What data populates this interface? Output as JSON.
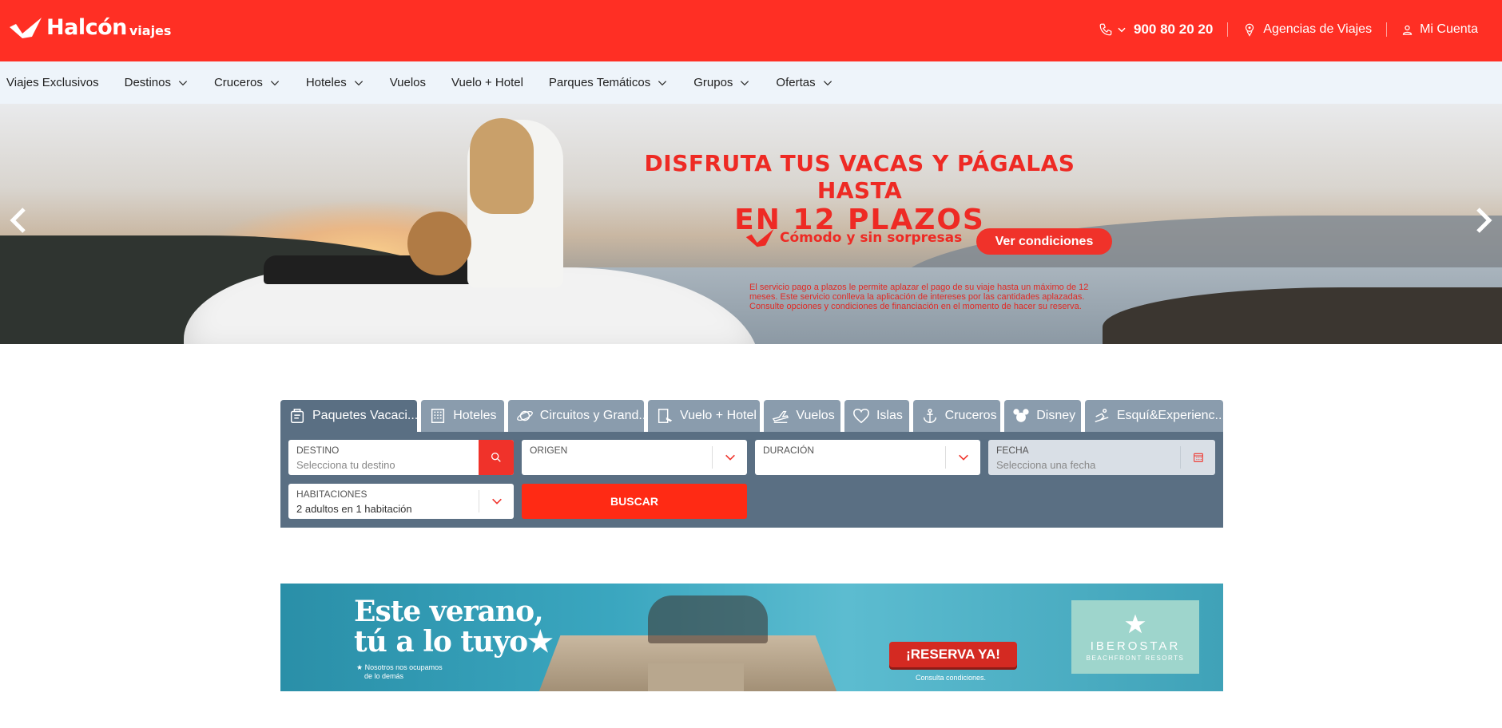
{
  "header": {
    "brand": "Halcón",
    "brand_sub": "viajes",
    "phone": "900 80 20 20",
    "agencias": "Agencias de Viajes",
    "cuenta": "Mi Cuenta"
  },
  "nav": {
    "items": [
      {
        "label": "Viajes Exclusivos",
        "dropdown": false
      },
      {
        "label": "Destinos",
        "dropdown": true
      },
      {
        "label": "Cruceros",
        "dropdown": true
      },
      {
        "label": "Hoteles",
        "dropdown": true
      },
      {
        "label": "Vuelos",
        "dropdown": false
      },
      {
        "label": "Vuelo + Hotel",
        "dropdown": false
      },
      {
        "label": "Parques Temáticos",
        "dropdown": true
      },
      {
        "label": "Grupos",
        "dropdown": true
      },
      {
        "label": "Ofertas",
        "dropdown": true
      }
    ]
  },
  "hero": {
    "title": "DISFRUTA TUS VACAS Y PÁGALAS HASTA",
    "subtitle": "EN 12 PLAZOS",
    "slogan": "Cómodo y sin sorpresas",
    "button": "Ver condiciones",
    "fine_print": "El servicio pago a plazos le permite aplazar el pago de su viaje hasta un máximo de 12 meses. Este servicio conlleva la aplicación de intereses por las cantidades aplazadas. Consulte opciones y condiciones de financiación en el momento de hacer su reserva."
  },
  "search": {
    "tabs": [
      {
        "label": "Paquetes Vacaci...",
        "icon": "package-icon",
        "active": true
      },
      {
        "label": "Hoteles",
        "icon": "hotel-icon",
        "active": false
      },
      {
        "label": "Circuitos y Grand...",
        "icon": "planet-icon",
        "active": false
      },
      {
        "label": "Vuelo + Hotel",
        "icon": "flight-hotel-icon",
        "active": false
      },
      {
        "label": "Vuelos",
        "icon": "plane-icon",
        "active": false
      },
      {
        "label": "Islas",
        "icon": "heart-icon",
        "active": false
      },
      {
        "label": "Cruceros",
        "icon": "anchor-icon",
        "active": false
      },
      {
        "label": "Disney",
        "icon": "mickey-icon",
        "active": false
      },
      {
        "label": "Esquí&Experienc...",
        "icon": "ski-icon",
        "active": false
      }
    ],
    "destino": {
      "label": "DESTINO",
      "placeholder": "Selecciona tu destino"
    },
    "origen": {
      "label": "ORIGEN",
      "value": ""
    },
    "duracion": {
      "label": "DURACIÓN",
      "value": ""
    },
    "fecha": {
      "label": "FECHA",
      "placeholder": "Selecciona una fecha"
    },
    "habitaciones": {
      "label": "HABITACIONES",
      "value": "2 adultos en 1 habitación"
    },
    "buscar": "BUSCAR"
  },
  "banner": {
    "headline_1": "Este verano,",
    "headline_2": "tú a lo tuyo★",
    "small_1": "★ Nosotros nos ocupamos",
    "small_2": "de lo demás",
    "reserva": "¡RESERVA YA!",
    "consulta": "Consulta condiciones.",
    "partner": "IBEROSTAR",
    "partner_tag": "BEACHFRONT RESORTS"
  },
  "colors": {
    "brand_red": "#ff2f24",
    "nav_bg": "#eef4fa",
    "search_panel": "#5a6f83",
    "tab_inactive": "#8a9cad"
  }
}
